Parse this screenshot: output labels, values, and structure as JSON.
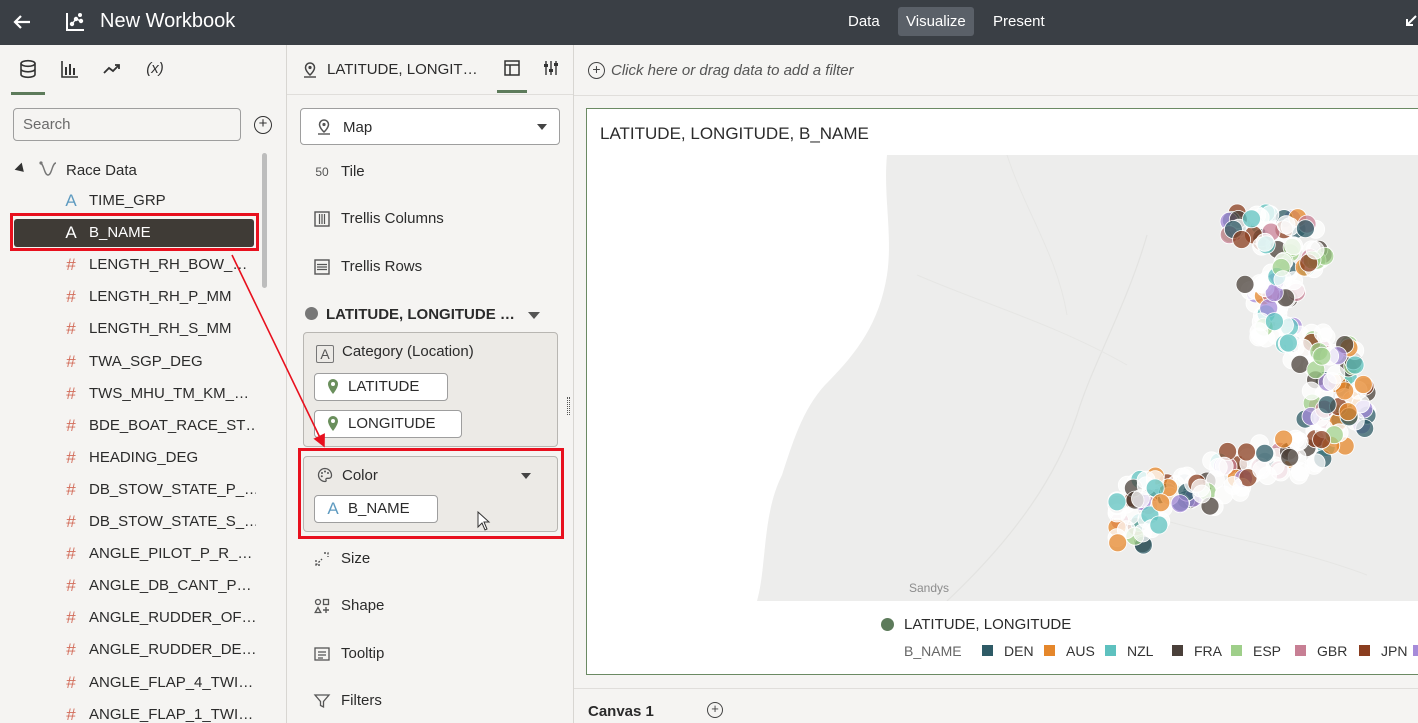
{
  "header": {
    "title": "New Workbook",
    "nav": [
      {
        "label": "Data",
        "active": false
      },
      {
        "label": "Visualize",
        "active": true
      },
      {
        "label": "Present",
        "active": false
      }
    ],
    "back_icon": "arrow-left-icon",
    "logo_icon": "workbook-logo-icon"
  },
  "left_panel": {
    "tabs": [
      {
        "icon": "database-icon",
        "active": true
      },
      {
        "icon": "bar-chart-icon",
        "active": false
      },
      {
        "icon": "trend-arrow-icon",
        "active": false
      },
      {
        "icon": "function-icon",
        "label": "(x)",
        "active": false
      }
    ],
    "search": {
      "placeholder": "Search"
    },
    "tree_root": "Race Data",
    "columns": [
      {
        "name": "TIME_GRP",
        "type": "text",
        "selected": false
      },
      {
        "name": "B_NAME",
        "type": "text",
        "selected": true
      },
      {
        "name": "LENGTH_RH_BOW_…",
        "type": "number",
        "selected": false
      },
      {
        "name": "LENGTH_RH_P_MM",
        "type": "number",
        "selected": false
      },
      {
        "name": "LENGTH_RH_S_MM",
        "type": "number",
        "selected": false
      },
      {
        "name": "TWA_SGP_DEG",
        "type": "number",
        "selected": false
      },
      {
        "name": "TWS_MHU_TM_KM_…",
        "type": "number",
        "selected": false
      },
      {
        "name": "BDE_BOAT_RACE_ST…",
        "type": "number",
        "selected": false
      },
      {
        "name": "HEADING_DEG",
        "type": "number",
        "selected": false
      },
      {
        "name": "DB_STOW_STATE_P_…",
        "type": "number",
        "selected": false
      },
      {
        "name": "DB_STOW_STATE_S_…",
        "type": "number",
        "selected": false
      },
      {
        "name": "ANGLE_PILOT_P_R_…",
        "type": "number",
        "selected": false
      },
      {
        "name": "ANGLE_DB_CANT_P…",
        "type": "number",
        "selected": false
      },
      {
        "name": "ANGLE_RUDDER_OF…",
        "type": "number",
        "selected": false
      },
      {
        "name": "ANGLE_RUDDER_DE…",
        "type": "number",
        "selected": false
      },
      {
        "name": "ANGLE_FLAP_4_TWI…",
        "type": "number",
        "selected": false
      },
      {
        "name": "ANGLE_FLAP_1_TWI…",
        "type": "number",
        "selected": false
      }
    ]
  },
  "grammar_panel": {
    "header_title": "LATITUDE, LONGIT…",
    "viz_type": "Map",
    "top_items": [
      "Tile",
      "Trellis Columns",
      "Trellis Rows"
    ],
    "layer_title": "LATITUDE, LONGITUDE …",
    "category_zone": {
      "label": "Category (Location)",
      "pills": [
        "LATITUDE",
        "LONGITUDE"
      ]
    },
    "color_zone": {
      "label": "Color",
      "pill": "B_NAME"
    },
    "bottom_items": [
      "Size",
      "Shape",
      "Tooltip",
      "Filters"
    ]
  },
  "canvas": {
    "filter_hint": "Click here or drag data to add a filter",
    "viz_title": "LATITUDE, LONGITUDE, B_NAME",
    "map_place_label": "Sandys",
    "legend": {
      "layer_label": "LATITUDE, LONGITUDE",
      "color_by_label": "B_NAME",
      "items": [
        {
          "label": "DEN",
          "color": "#2e5b66"
        },
        {
          "label": "AUS",
          "color": "#e5872b"
        },
        {
          "label": "NZL",
          "color": "#5ec1bf"
        },
        {
          "label": "FRA",
          "color": "#4a403a"
        },
        {
          "label": "ESP",
          "color": "#9fcf8a"
        },
        {
          "label": "GBR",
          "color": "#c77f94"
        },
        {
          "label": "JPN",
          "color": "#8a3d1f"
        },
        {
          "label": "",
          "color": "#a68bd9"
        }
      ]
    },
    "canvas_tab": "Canvas 1"
  },
  "colors": {
    "accent": "#5d7b5b",
    "highlight": "#e8101e",
    "topbar": "#3a3f45"
  }
}
